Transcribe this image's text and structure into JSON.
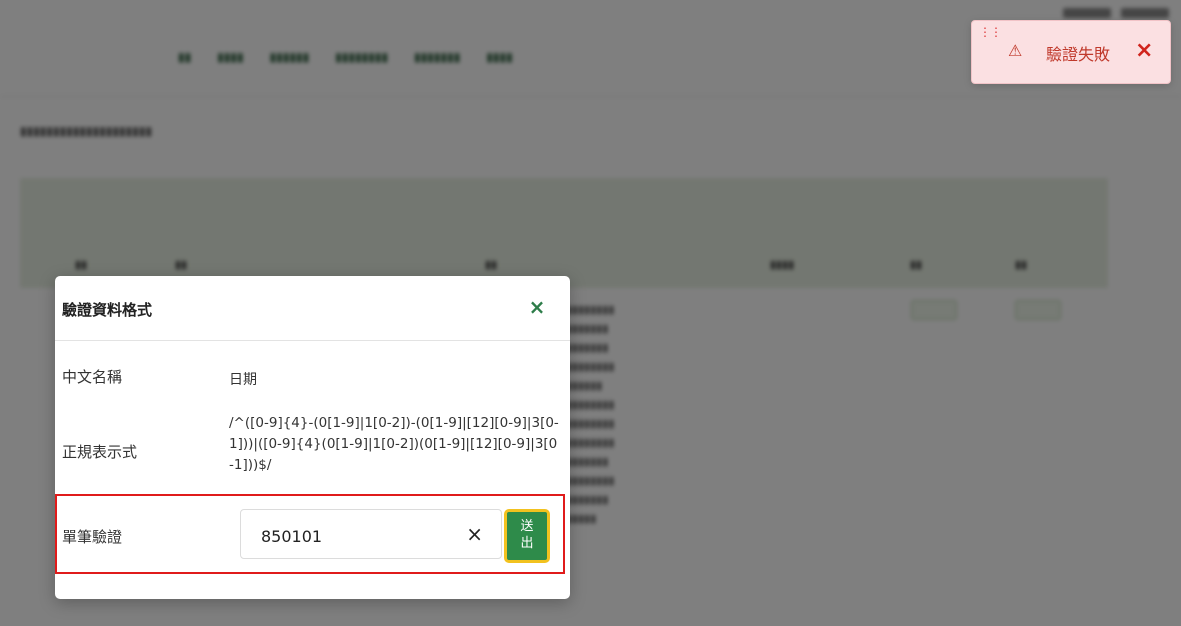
{
  "modal": {
    "title": "驗證資料格式",
    "close_label": "×",
    "fields": {
      "chinese_name_label": "中文名稱",
      "chinese_name_value": "日期",
      "regex_label": "正規表示式",
      "regex_value": "/^([0-9]{4}-(0[1-9]|1[0-2])-(0[1-9]|[12][0-9]|3[0-1]))|([0-9]{4}(0[1-9]|1[0-2])(0[1-9]|[12][0-9]|3[0-1]))$/",
      "single_validate_label": "單筆驗證",
      "single_validate_value": "850101",
      "clear_label": "×",
      "submit_label_line1": "送",
      "submit_label_line2": "出"
    },
    "highlight_color": "#e01b1b"
  },
  "toast": {
    "grip": "⋮⋮",
    "icon": "⚠",
    "message": "驗證失敗",
    "close_label": "×",
    "color": "#c0392b"
  },
  "colors": {
    "accent_green": "#2e8b4a",
    "submit_border": "#f2c21f",
    "toast_bg": "#fbe0e2"
  }
}
